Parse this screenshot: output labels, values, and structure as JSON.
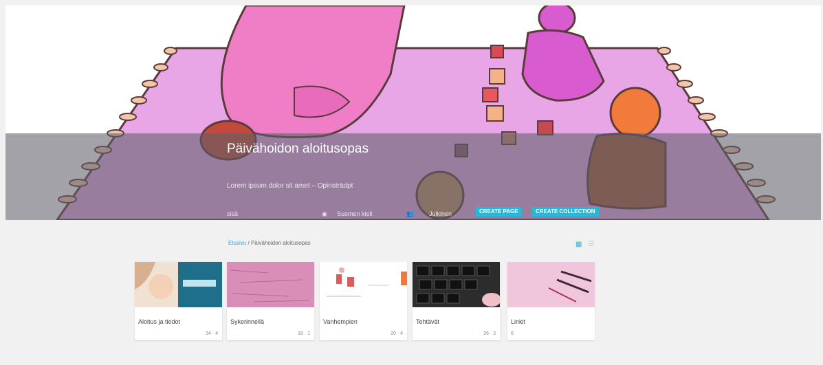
{
  "header": {
    "title": "Päivähoidon aloitusopas",
    "subtitle": "Lorem ipsum dolor sit amet – Opinsträdpt",
    "meta_left": "sisä",
    "stat_1_icon": "eye-icon",
    "stat_1": "Suomen kieli",
    "stat_2_icon": "people-icon",
    "stat_2": "Julkinen",
    "create_page_label": "CREATE PAGE",
    "create_collection_label": "CREATE COLLECTION",
    "accent_color": "#29b6d8"
  },
  "breadcrumb": {
    "home": "Etusivu",
    "separator": "/",
    "current": "Päivähoidon aloitusopas"
  },
  "view_toggle": {
    "grid_icon": "grid-view-icon",
    "list_icon": "list-view-icon"
  },
  "cards": [
    {
      "title": "Aloitus ja tiedot",
      "footer": "34 · 4"
    },
    {
      "title": "Sykerinnellä",
      "footer": "18 · 1"
    },
    {
      "title": "Vanhempien",
      "footer": "20 · 4"
    },
    {
      "title": "Tehtävät",
      "footer": "26 · 3"
    },
    {
      "title": "Linkit",
      "footer": "6"
    }
  ]
}
